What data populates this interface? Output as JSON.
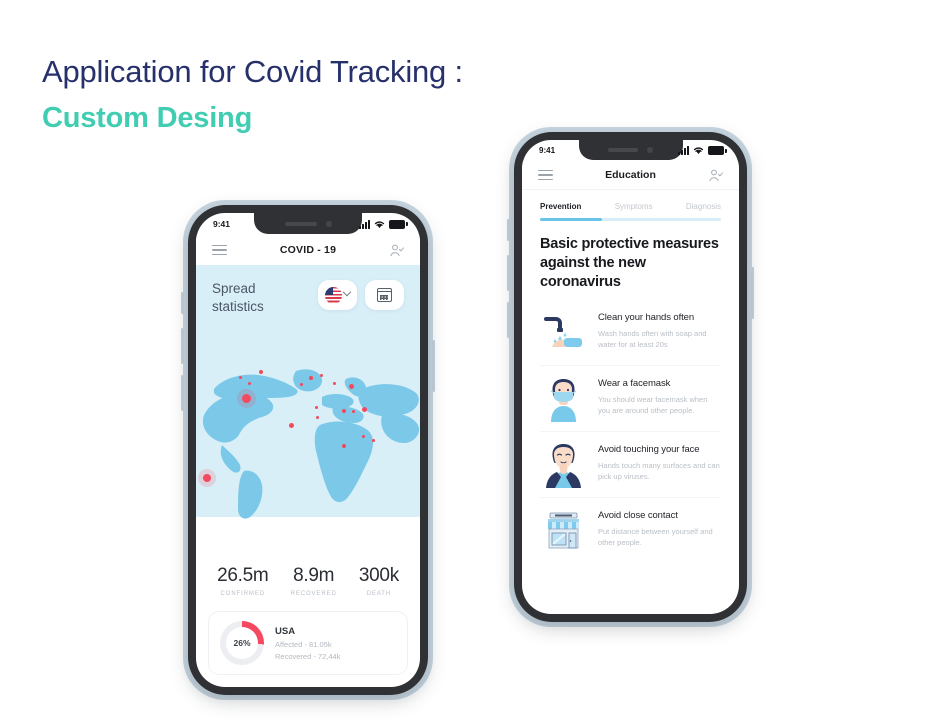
{
  "headline": {
    "line1": "Application for Covid Tracking :",
    "line2": "Custom Desing",
    "color1": "#26306b",
    "color2": "#40cdb2"
  },
  "phone_left": {
    "status": {
      "time": "9:41",
      "signal_icon": "signal-bars-icon",
      "wifi_icon": "wifi-icon",
      "battery_icon": "battery-icon"
    },
    "appbar": {
      "menu_icon": "hamburger-menu-icon",
      "title": "COVID - 19",
      "profile_icon": "user-check-icon"
    },
    "spread": {
      "title_line1": "Spread",
      "title_line2": "statistics",
      "flag_label": "US flag",
      "flag_icon": "usa-flag-icon",
      "chevron_icon": "chevron-down-icon",
      "calendar_icon": "calendar-icon"
    },
    "map": {
      "background_color": "#d8eff8",
      "land_color": "#77c7e8",
      "dot_color": "#f4495f"
    },
    "stats": [
      {
        "value": "26.5m",
        "label": "CONFIRMED"
      },
      {
        "value": "8.9m",
        "label": "RECOVERED"
      },
      {
        "value": "300k",
        "label": "DEATH"
      }
    ],
    "country_card": {
      "percent": "26%",
      "percent_value": 26,
      "name": "USA",
      "affected": "Affected - 81.05k",
      "recovered": "Recovered - 72,44k",
      "arc_color": "#f4495f"
    },
    "bottom_button": {
      "icon": "face-mask-icon",
      "chart_icon": "trend-line-icon",
      "color": "#79c9ea"
    }
  },
  "phone_right": {
    "status": {
      "time": "9:41",
      "signal_icon": "signal-bars-icon",
      "wifi_icon": "wifi-icon",
      "battery_icon": "battery-icon"
    },
    "appbar": {
      "menu_icon": "hamburger-menu-icon",
      "title": "Education",
      "profile_icon": "user-check-icon"
    },
    "tabs": [
      {
        "label": "Prevention",
        "active": true
      },
      {
        "label": "Symptoms",
        "active": false
      },
      {
        "label": "Diagnosis",
        "active": false
      }
    ],
    "tab_indicator_color": "#6bc5e8",
    "heading": "Basic protective measures against the new coronavirus",
    "items": [
      {
        "icon": "hand-washing-icon",
        "title": "Clean your hands often",
        "desc": "Wash hands often with soap and water for at least 20s"
      },
      {
        "icon": "person-facemask-icon",
        "title": "Wear a facemask",
        "desc": "You should wear facemask when you are around other people."
      },
      {
        "icon": "person-touching-face-icon",
        "title": "Avoid touching your face",
        "desc": "Hands touch many surfaces and can pick up viruses."
      },
      {
        "icon": "market-store-icon",
        "title": "Avoid close contact",
        "desc": "Put distance between yourself and other people."
      }
    ]
  }
}
